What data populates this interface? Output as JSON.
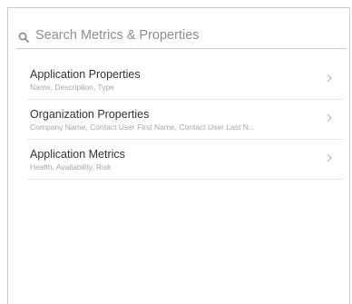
{
  "search": {
    "placeholder": "Search Metrics & Properties",
    "value": ""
  },
  "icons": {
    "search": "search-icon",
    "chevron": "chevron-right-icon"
  },
  "items": [
    {
      "title": "Application Properties",
      "subtitle": "Name, Description, Type"
    },
    {
      "title": "Organization Properties",
      "subtitle": "Company Name, Contact User First Name, Contact User Last N..."
    },
    {
      "title": "Application Metrics",
      "subtitle": "Health, Availability, Risk"
    }
  ]
}
